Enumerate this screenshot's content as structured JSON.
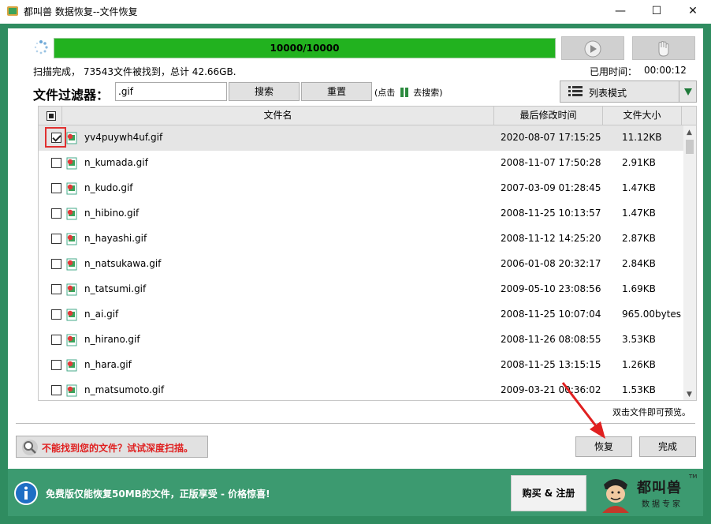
{
  "window": {
    "title": "都叫兽 数据恢复--文件恢复",
    "minimize": "—",
    "maximize": "☐",
    "close": "✕"
  },
  "progress": {
    "text": "10000/10000",
    "fraction": 1.0
  },
  "status": {
    "scan_text": "扫描完成， 73543文件被找到，总计 42.66GB.",
    "elapsed_label": "已用时间：",
    "elapsed_value": "00:00:12"
  },
  "filter": {
    "label": "文件过滤器：",
    "value": ".gif",
    "search_button": "搜索",
    "reset_button": "重置",
    "hint_prefix": "(点击",
    "hint_suffix": "去搜索)"
  },
  "view_mode": {
    "label": "列表模式"
  },
  "table": {
    "columns": [
      "文件名",
      "最后修改时间",
      "文件大小"
    ],
    "rows": [
      {
        "name": "yv4puywh4uf.gif",
        "modified": "2020-08-07 17:15:25",
        "size": "11.12KB",
        "checked": true,
        "selected": true
      },
      {
        "name": "n_kumada.gif",
        "modified": "2008-11-07 17:50:28",
        "size": "2.91KB",
        "checked": false,
        "selected": false
      },
      {
        "name": "n_kudo.gif",
        "modified": "2007-03-09 01:28:45",
        "size": "1.47KB",
        "checked": false,
        "selected": false
      },
      {
        "name": "n_hibino.gif",
        "modified": "2008-11-25 10:13:57",
        "size": "1.47KB",
        "checked": false,
        "selected": false
      },
      {
        "name": "n_hayashi.gif",
        "modified": "2008-11-12 14:25:20",
        "size": "2.87KB",
        "checked": false,
        "selected": false
      },
      {
        "name": "n_natsukawa.gif",
        "modified": "2006-01-08 20:32:17",
        "size": "2.84KB",
        "checked": false,
        "selected": false
      },
      {
        "name": "n_tatsumi.gif",
        "modified": "2009-05-10 23:08:56",
        "size": "1.69KB",
        "checked": false,
        "selected": false
      },
      {
        "name": "n_ai.gif",
        "modified": "2008-11-25 10:07:04",
        "size": "965.00bytes",
        "checked": false,
        "selected": false
      },
      {
        "name": "n_hirano.gif",
        "modified": "2008-11-26 08:08:55",
        "size": "3.53KB",
        "checked": false,
        "selected": false
      },
      {
        "name": "n_hara.gif",
        "modified": "2008-11-25 13:15:15",
        "size": "1.26KB",
        "checked": false,
        "selected": false
      },
      {
        "name": "n_matsumoto.gif",
        "modified": "2009-03-21 00:36:02",
        "size": "1.53KB",
        "checked": false,
        "selected": false
      }
    ]
  },
  "preview_hint": "双击文件即可预览。",
  "deep_scan_button": "不能找到您的文件？试试深度扫描。",
  "recover_button": "恢复",
  "done_button": "完成",
  "footer": {
    "text": "免费版仅能恢复50MB的文件，正版享受 - 价格惊喜!",
    "buy_button": "购买 & 注册",
    "logo_brand": "都叫兽",
    "logo_tm": "TM",
    "logo_sub": "数据专家"
  },
  "colors": {
    "progress_fill": "#22b21f",
    "frame_green": "#2f8c60",
    "footer_green": "#3c9a70",
    "alert_red": "#e02020"
  },
  "icons": {
    "app": "app-logo-icon",
    "spinner": "loading-spinner-icon",
    "play": "play-icon",
    "stop": "hand-stop-icon",
    "list": "list-view-icon",
    "file": "gif-file-icon",
    "magnifier": "magnifier-icon",
    "info": "info-icon"
  }
}
